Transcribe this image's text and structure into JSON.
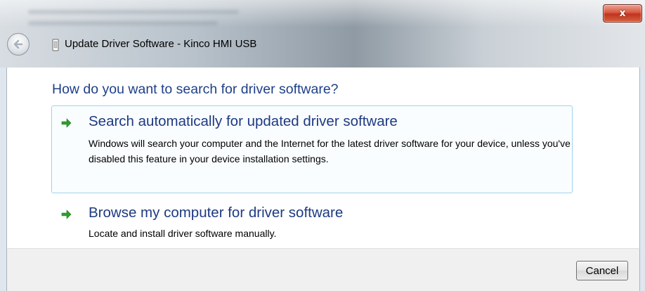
{
  "window": {
    "title": "Update Driver Software - Kinco HMI USB",
    "close_label": "x"
  },
  "wizard": {
    "heading": "How do you want to search for driver software?",
    "options": [
      {
        "title": "Search automatically for updated driver software",
        "description": "Windows will search your computer and the Internet for the latest driver software for your device, unless you've disabled this feature in your device installation settings."
      },
      {
        "title": "Browse my computer for driver software",
        "description": "Locate and install driver software manually."
      }
    ]
  },
  "footer": {
    "cancel_label": "Cancel"
  },
  "colors": {
    "heading": "#1e3f8a",
    "option_title": "#1d3a82",
    "arrow": "#2f9e2f",
    "highlight_border": "#9fd3ea",
    "close_button": "#c9452e"
  },
  "icons": {
    "back": "back-arrow-icon",
    "device": "usb-device-icon",
    "option": "green-arrow-icon",
    "close": "close-icon"
  }
}
